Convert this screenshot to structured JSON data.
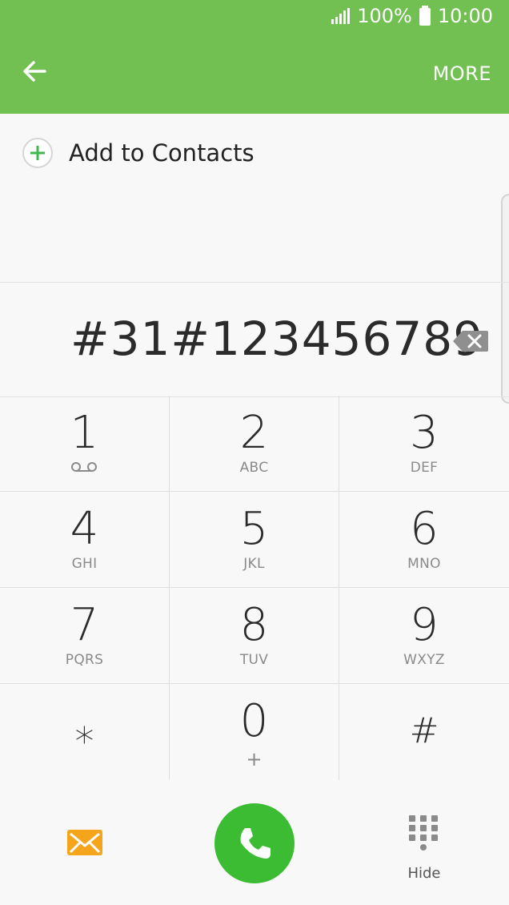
{
  "status": {
    "battery": "100%",
    "time": "10:00"
  },
  "appbar": {
    "more_label": "MORE"
  },
  "contacts": {
    "add_label": "Add to Contacts"
  },
  "dialer": {
    "number": "#31#123456789"
  },
  "keys": [
    {
      "digit": "1",
      "sub": ""
    },
    {
      "digit": "2",
      "sub": "ABC"
    },
    {
      "digit": "3",
      "sub": "DEF"
    },
    {
      "digit": "4",
      "sub": "GHI"
    },
    {
      "digit": "5",
      "sub": "JKL"
    },
    {
      "digit": "6",
      "sub": "MNO"
    },
    {
      "digit": "7",
      "sub": "PQRS"
    },
    {
      "digit": "8",
      "sub": "TUV"
    },
    {
      "digit": "9",
      "sub": "WXYZ"
    },
    {
      "digit": "⁎",
      "sub": ""
    },
    {
      "digit": "0",
      "sub": "+"
    },
    {
      "digit": "#",
      "sub": ""
    }
  ],
  "bottom": {
    "hide_label": "Hide"
  },
  "colors": {
    "accent": "#72bf52",
    "call": "#3cbc32",
    "message": "#f4a51c"
  },
  "icons": [
    "back-arrow-icon",
    "signal-icon",
    "battery-icon",
    "add-contact-icon",
    "backspace-icon",
    "voicemail-icon",
    "message-icon",
    "phone-icon",
    "keypad-icon"
  ]
}
